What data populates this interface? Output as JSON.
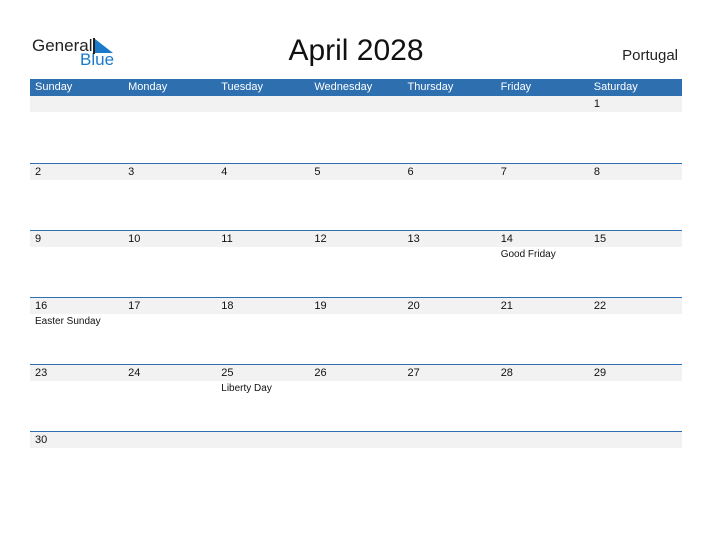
{
  "logo": {
    "general": "General",
    "blue": "Blue"
  },
  "title": "April 2028",
  "country": "Portugal",
  "weekdays": [
    "Sunday",
    "Monday",
    "Tuesday",
    "Wednesday",
    "Thursday",
    "Friday",
    "Saturday"
  ],
  "weeks": [
    [
      {
        "d": ""
      },
      {
        "d": ""
      },
      {
        "d": ""
      },
      {
        "d": ""
      },
      {
        "d": ""
      },
      {
        "d": ""
      },
      {
        "d": "1"
      }
    ],
    [
      {
        "d": "2"
      },
      {
        "d": "3"
      },
      {
        "d": "4"
      },
      {
        "d": "5"
      },
      {
        "d": "6"
      },
      {
        "d": "7"
      },
      {
        "d": "8"
      }
    ],
    [
      {
        "d": "9"
      },
      {
        "d": "10"
      },
      {
        "d": "11"
      },
      {
        "d": "12"
      },
      {
        "d": "13"
      },
      {
        "d": "14",
        "h": "Good Friday"
      },
      {
        "d": "15"
      }
    ],
    [
      {
        "d": "16",
        "h": "Easter Sunday"
      },
      {
        "d": "17"
      },
      {
        "d": "18"
      },
      {
        "d": "19"
      },
      {
        "d": "20"
      },
      {
        "d": "21"
      },
      {
        "d": "22"
      }
    ],
    [
      {
        "d": "23"
      },
      {
        "d": "24"
      },
      {
        "d": "25",
        "h": "Liberty Day"
      },
      {
        "d": "26"
      },
      {
        "d": "27"
      },
      {
        "d": "28"
      },
      {
        "d": "29"
      }
    ],
    [
      {
        "d": "30"
      },
      {
        "d": ""
      },
      {
        "d": ""
      },
      {
        "d": ""
      },
      {
        "d": ""
      },
      {
        "d": ""
      },
      {
        "d": ""
      }
    ]
  ]
}
